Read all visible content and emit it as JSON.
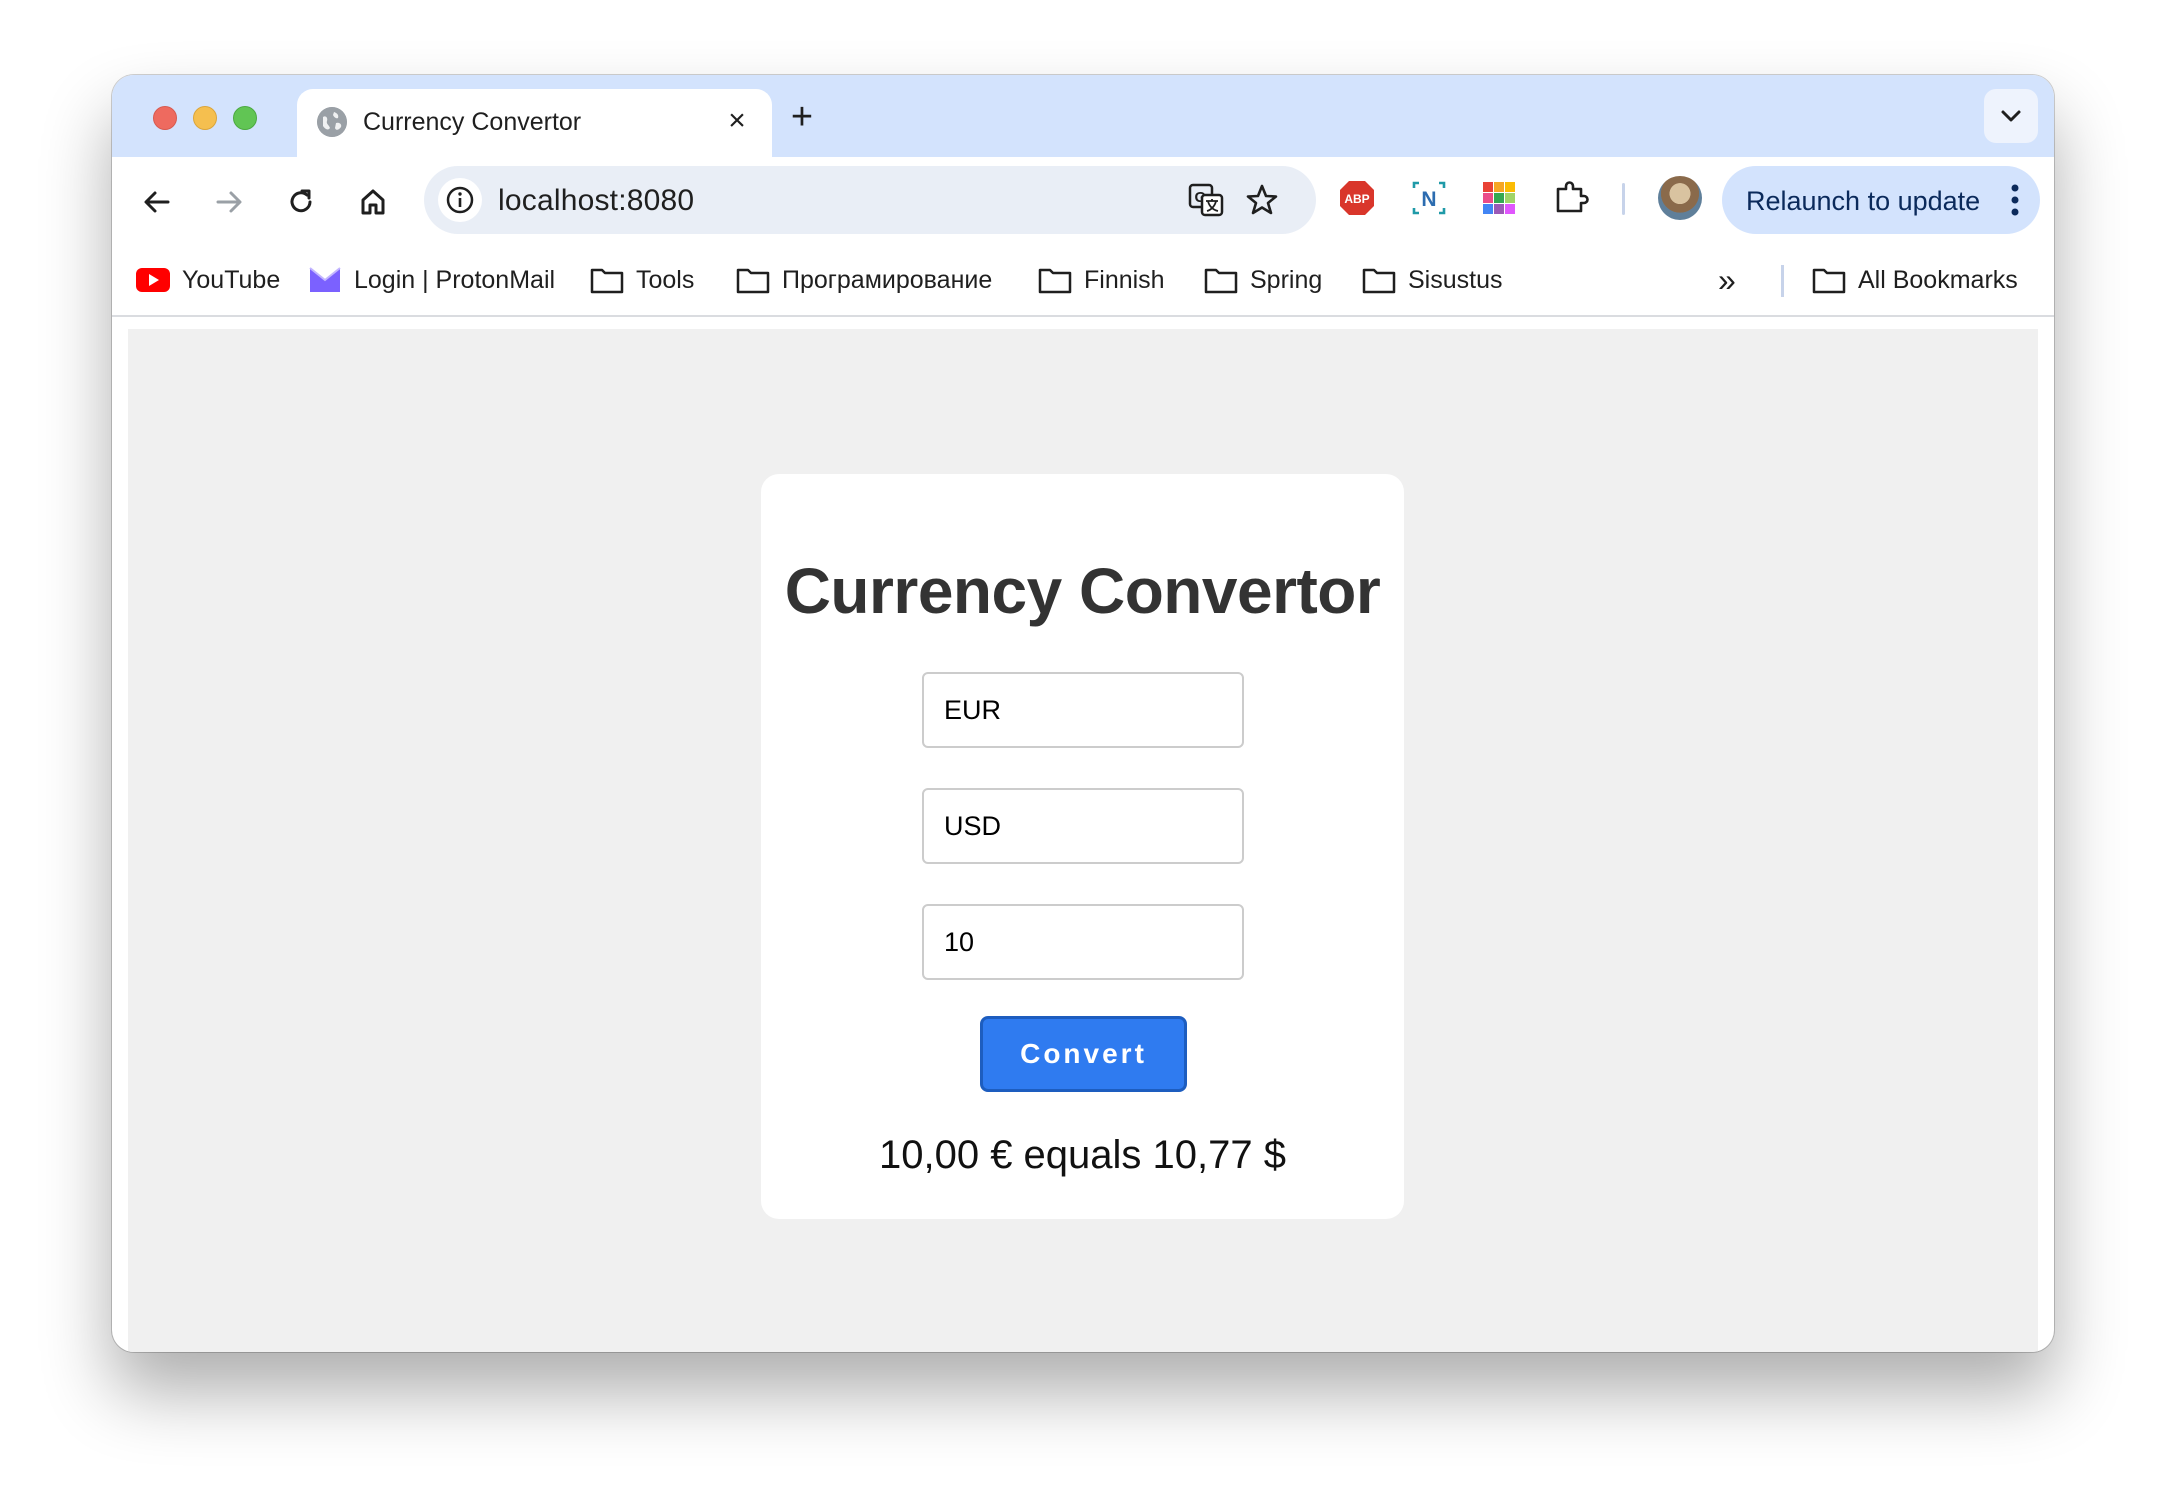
{
  "window": {
    "traffic_lights": [
      "close",
      "minimize",
      "zoom"
    ]
  },
  "tab": {
    "title": "Currency Convertor",
    "close_glyph": "×",
    "new_tab_glyph": "+"
  },
  "toolbar": {
    "url": "localhost:8080",
    "relaunch_label": "Relaunch to update",
    "extensions": [
      "abp-icon",
      "notion-web-clipper-icon",
      "color-grid-icon",
      "extensions-puzzle-icon"
    ]
  },
  "bookmarks": {
    "items": [
      {
        "label": "YouTube",
        "icon": "youtube-icon"
      },
      {
        "label": "Login | ProtonMail",
        "icon": "protonmail-icon"
      },
      {
        "label": "Tools",
        "icon": "folder-icon"
      },
      {
        "label": "Програмирование",
        "icon": "folder-icon"
      },
      {
        "label": "Finnish",
        "icon": "folder-icon"
      },
      {
        "label": "Spring",
        "icon": "folder-icon"
      },
      {
        "label": "Sisustus",
        "icon": "folder-icon"
      }
    ],
    "overflow_glyph": "»",
    "all_bookmarks": "All Bookmarks"
  },
  "page": {
    "title": "Currency Convertor",
    "from_currency": "EUR",
    "to_currency": "USD",
    "amount": "10",
    "convert_label": "Convert",
    "result": "10,00 € equals 10,77 $"
  },
  "colors": {
    "tabstrip": "#d3e3fd",
    "page_background": "#f0f0f0",
    "button": "#2f7bf0",
    "title_text": "#333333"
  }
}
